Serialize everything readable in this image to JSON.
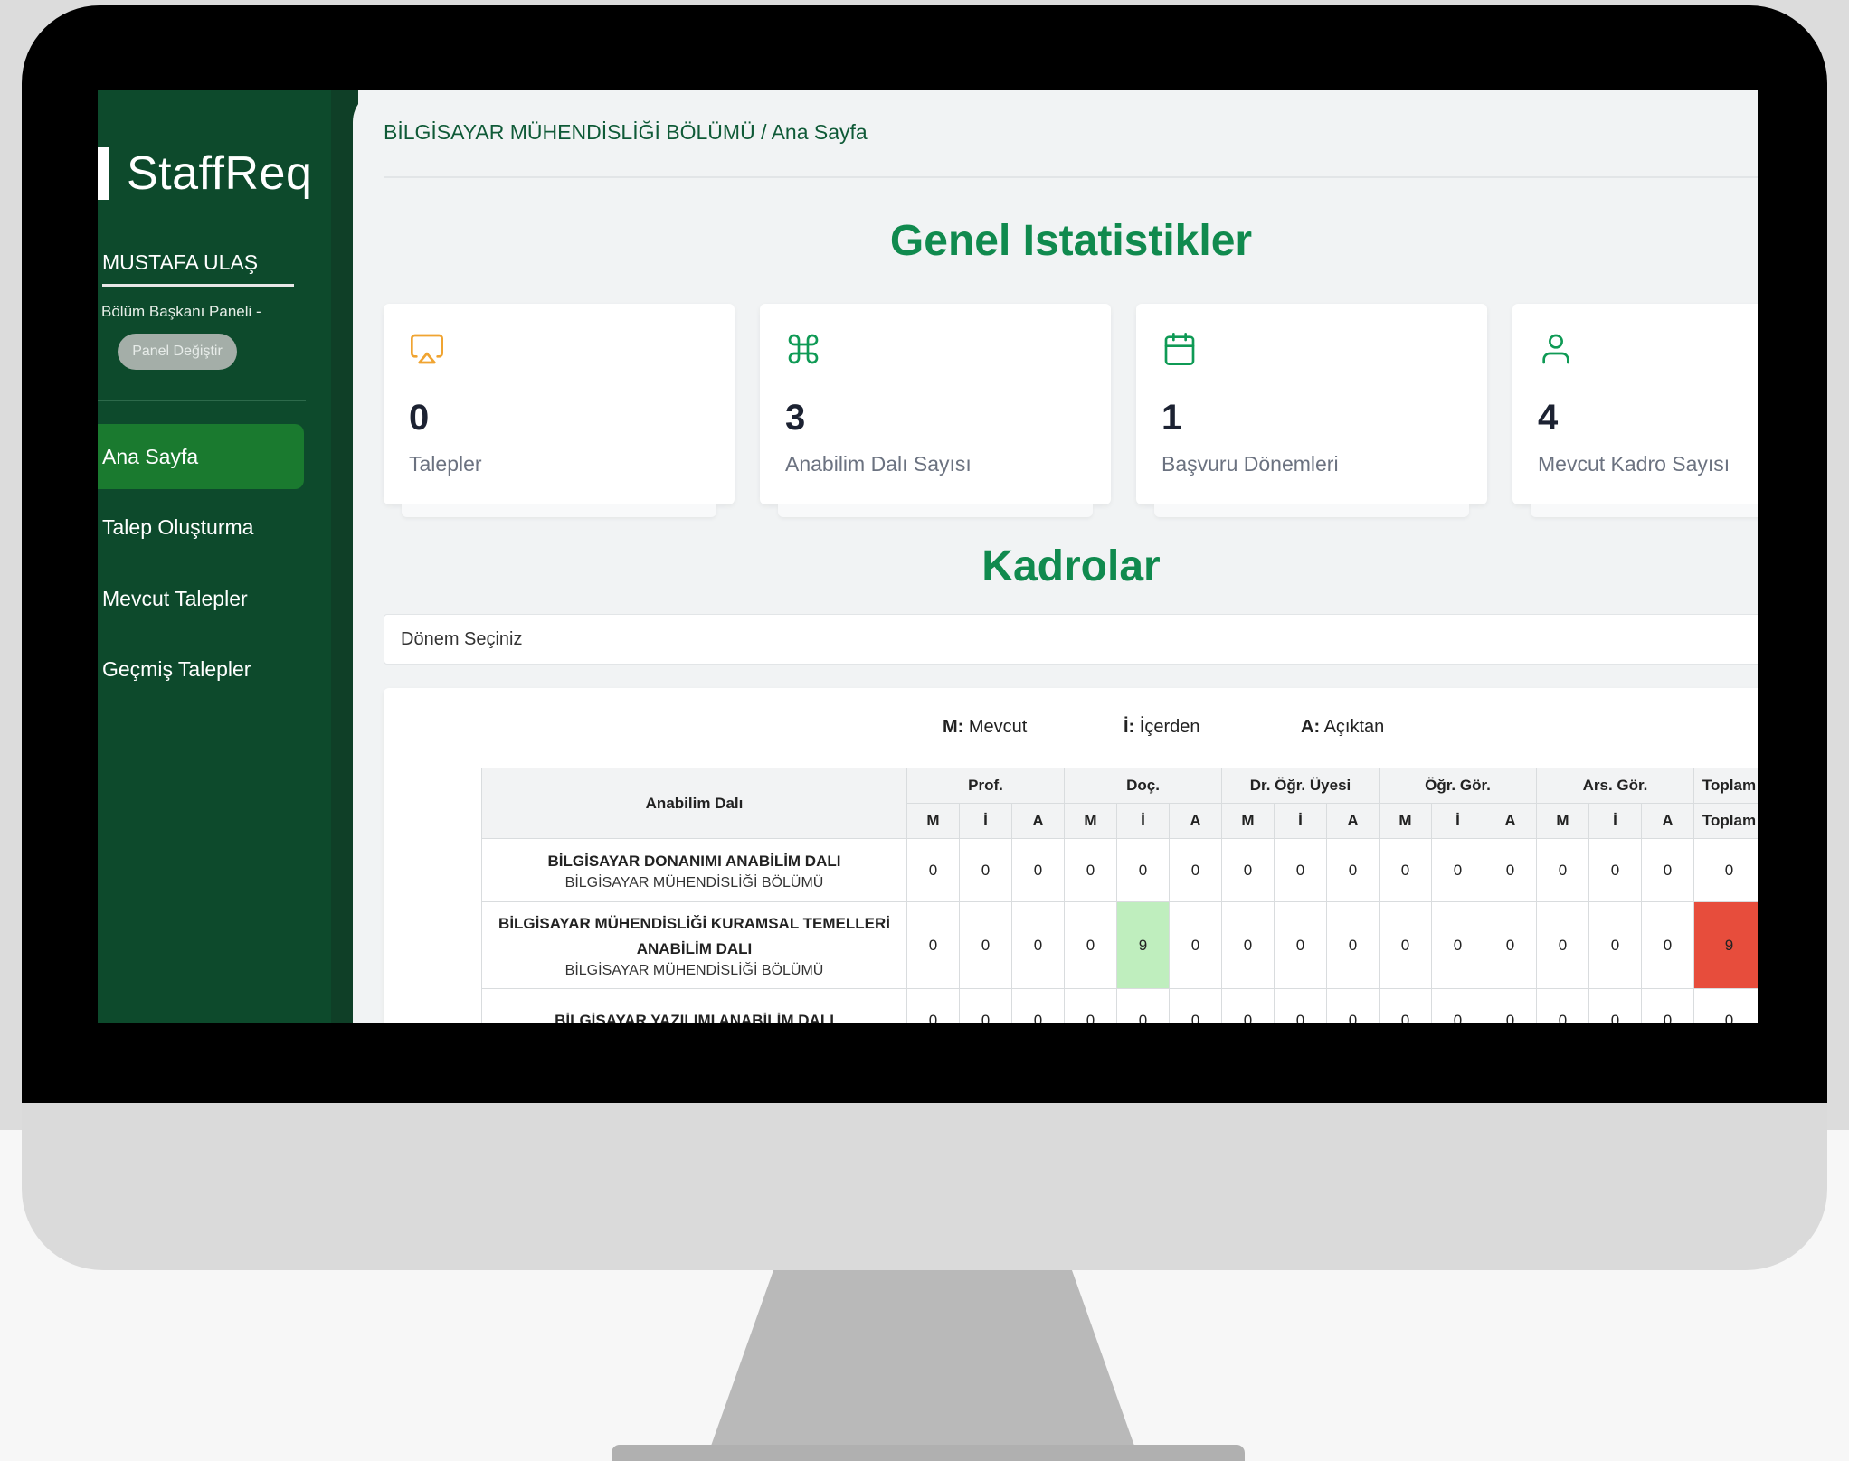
{
  "app": {
    "logo_text": "StaffReq"
  },
  "sidebar": {
    "user_name": "MUSTAFA ULAŞ",
    "panel_subtitle": "Bölüm Başkanı Paneli -",
    "panel_switch_label": "Panel Değiştir",
    "items": [
      {
        "label": "Ana Sayfa",
        "active": true
      },
      {
        "label": "Talep Oluşturma",
        "active": false
      },
      {
        "label": "Mevcut Talepler",
        "active": false
      },
      {
        "label": "Geçmiş Talepler",
        "active": false
      }
    ]
  },
  "header": {
    "department": "BİLGİSAYAR MÜHENDİSLİĞİ BÖLÜMÜ",
    "separator": "/",
    "page": "Ana Sayfa"
  },
  "stats": {
    "title": "Genel Istatistikler",
    "cards": [
      {
        "value": "0",
        "label": "Talepler",
        "icon": "airplay-icon",
        "icon_color": "#f0a431"
      },
      {
        "value": "3",
        "label": "Anabilim Dalı Sayısı",
        "icon": "command-icon",
        "icon_color": "#0f9a55"
      },
      {
        "value": "1",
        "label": "Başvuru Dönemleri",
        "icon": "calendar-icon",
        "icon_color": "#0f9a55"
      },
      {
        "value": "4",
        "label": "Mevcut Kadro Sayısı",
        "icon": "user-icon",
        "icon_color": "#0f9a55"
      }
    ]
  },
  "kadrolar": {
    "title": "Kadrolar",
    "period_select_placeholder": "Dönem Seçiniz",
    "legend": [
      {
        "key": "M:",
        "text": "Mevcut"
      },
      {
        "key": "İ:",
        "text": "İçerden"
      },
      {
        "key": "A:",
        "text": "Açıktan"
      }
    ],
    "table": {
      "first_header": "Anabilim Dalı",
      "groups": [
        "Prof.",
        "Doç.",
        "Dr. Öğr. Üyesi",
        "Öğr. Gör.",
        "Ars. Gör.",
        "Toplam"
      ],
      "sub_headers": [
        "M",
        "İ",
        "A"
      ],
      "total_sub_header": "Toplam",
      "rows": [
        {
          "name": "BİLGİSAYAR DONANIMI ANABİLİM DALI",
          "department": "BİLGİSAYAR MÜHENDİSLİĞİ BÖLÜMÜ",
          "values": [
            "0",
            "0",
            "0",
            "0",
            "0",
            "0",
            "0",
            "0",
            "0",
            "0",
            "0",
            "0",
            "0",
            "0",
            "0"
          ],
          "total": "0"
        },
        {
          "name": "BİLGİSAYAR MÜHENDİSLİĞİ KURAMSAL TEMELLERİ ANABİLİM DALI",
          "department": "BİLGİSAYAR MÜHENDİSLİĞİ BÖLÜMÜ",
          "values": [
            "0",
            "0",
            "0",
            "0",
            "9",
            "0",
            "0",
            "0",
            "0",
            "0",
            "0",
            "0",
            "0",
            "0",
            "0"
          ],
          "total": "9"
        },
        {
          "name": "BİLGİSAYAR YAZILIMI ANABİLİM DALI",
          "department": "",
          "values": [
            "0",
            "0",
            "0",
            "0",
            "0",
            "0",
            "0",
            "0",
            "0",
            "0",
            "0",
            "0",
            "0",
            "0",
            "0"
          ],
          "total": "0"
        }
      ]
    },
    "highlight_colors": {
      "positive": "#bfeebe",
      "total_alert": "#e74d3c"
    }
  }
}
